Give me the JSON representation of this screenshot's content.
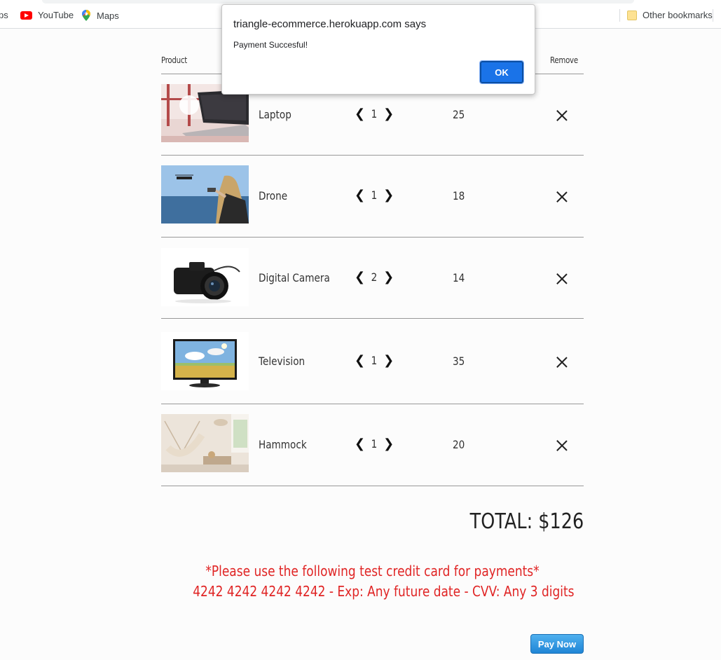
{
  "bookmarks": {
    "apps_label": "ps",
    "youtube_label": "YouTube",
    "maps_label": "Maps",
    "other_label": "Other bookmarks"
  },
  "cart": {
    "headers": {
      "product": "Product",
      "remove": "Remove"
    },
    "items": [
      {
        "name": "Laptop",
        "qty": "1",
        "price": "25",
        "image": "laptop-photo"
      },
      {
        "name": "Drone",
        "qty": "1",
        "price": "18",
        "image": "drone-photo"
      },
      {
        "name": "Digital Camera",
        "qty": "2",
        "price": "14",
        "image": "camera-photo"
      },
      {
        "name": "Television",
        "qty": "1",
        "price": "35",
        "image": "television-photo"
      },
      {
        "name": "Hammock",
        "qty": "1",
        "price": "20",
        "image": "hammock-photo"
      }
    ],
    "decrement_glyph": "❮",
    "increment_glyph": "❯",
    "total": "TOTAL: $126",
    "note_line1": "*Please use the following test credit card for payments*",
    "note_line2": "4242 4242 4242 4242 - Exp: Any future date - CVV: Any 3 digits",
    "pay_label": "Pay Now"
  },
  "dialog": {
    "title": "triangle-ecommerce.herokuapp.com says",
    "message": "Payment Succesful!",
    "ok_label": "OK"
  },
  "colors": {
    "note": "#e02424",
    "ok_button": "#1a73e8",
    "pay_button": "#1f85d6"
  }
}
